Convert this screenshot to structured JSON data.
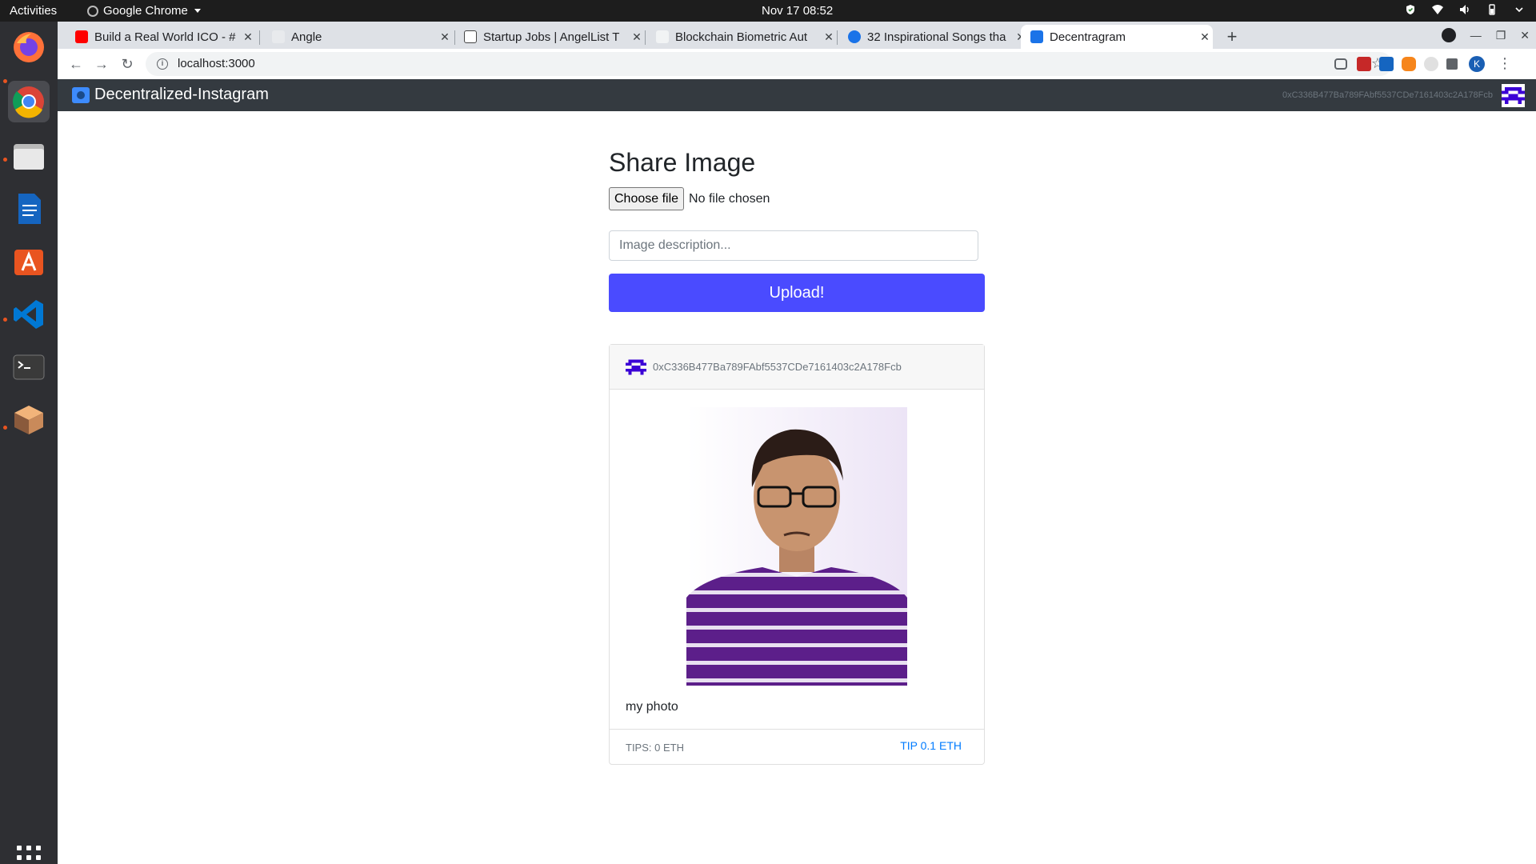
{
  "system_bar": {
    "activities": "Activities",
    "app_name": "Google Chrome",
    "clock": "Nov 17  08:52"
  },
  "dock": {
    "apps": [
      "firefox-icon",
      "chrome-icon",
      "files-icon",
      "writer-icon",
      "software-icon",
      "vscode-icon",
      "terminal-icon",
      "package-icon"
    ],
    "show_apps": "grid-icon"
  },
  "browser": {
    "tabs": [
      {
        "label": "Build a Real World ICO - #",
        "active": false
      },
      {
        "label": "Angle",
        "active": false
      },
      {
        "label": "Startup Jobs | AngelList T",
        "active": false
      },
      {
        "label": "Blockchain Biometric Aut",
        "active": false
      },
      {
        "label": "32 Inspirational Songs tha",
        "active": false
      },
      {
        "label": "Decentragram",
        "active": true
      }
    ],
    "url": "localhost:3000"
  },
  "navbar": {
    "brand": "Decentralized-Instagram",
    "account": "0xC336B477Ba789FAbf5537CDe7161403c2A178Fcb"
  },
  "share_form": {
    "heading": "Share Image",
    "file_button": "Choose file",
    "file_status": "No file chosen",
    "description_placeholder": "Image description...",
    "upload_label": "Upload!"
  },
  "post": {
    "author": "0xC336B477Ba789FAbf5537CDe7161403c2A178Fcb",
    "caption": "my photo",
    "tips": "TIPS: 0 ETH",
    "tip_action": "TIP 0.1 ETH"
  },
  "colors": {
    "navbar_bg": "#343a40",
    "upload_button": "#4a4bff",
    "link": "#007bff",
    "identicon": "#3b00d6",
    "shirt_purple": "#5c1f8a"
  }
}
